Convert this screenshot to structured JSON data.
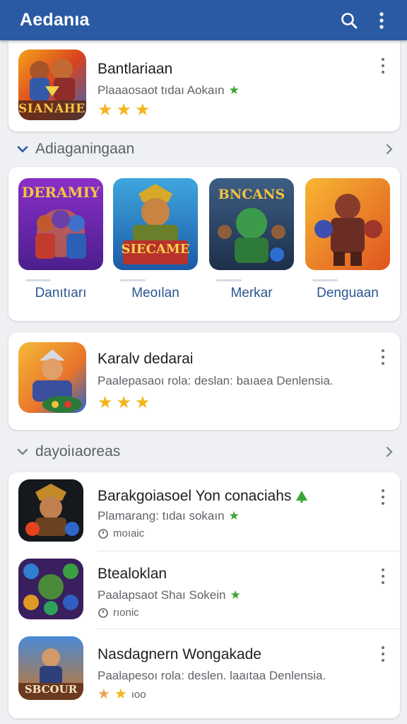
{
  "app_bar": {
    "title": "Aedanıa",
    "bg_color": "#2a5aa3",
    "search_icon": "search-icon",
    "more_icon": "more-vert-icon"
  },
  "featured": {
    "title": "Bantlariaan",
    "subtitle": "Plaaaosaot tıdaı Aokaın",
    "rating_stars": 3,
    "icon_text": "SIANAHES"
  },
  "section1": {
    "label": "Adiaganingaan",
    "expand_icon": "chevron-down-icon",
    "nav_icon": "chevron-right-icon"
  },
  "carousel": [
    {
      "label": "Danıtıarı",
      "art_text": "DERAMIY"
    },
    {
      "label": "Meoılan",
      "art_text": "SIECAME"
    },
    {
      "label": "Merkar",
      "art_text": "BNCANS"
    },
    {
      "label": "Denguaan",
      "art_text": ""
    }
  ],
  "card2": {
    "title": "Karalv dedarai",
    "subtitle": "Paaleраsaoı rola: deslan: baıaea Denlensia.",
    "rating_stars": 3
  },
  "section2": {
    "label": "dayoiıaoreas",
    "expand_icon": "chevron-down-icon",
    "nav_icon": "chevron-right-icon"
  },
  "list": [
    {
      "title": "Barakgoiasoel Yon conaciahs",
      "subtitle": "Plamarang: tıdaı sokaın",
      "meta": "moıaic",
      "rating_stars": 0,
      "badge": "tree-icon"
    },
    {
      "title": "Btealoklan",
      "subtitle": "Paalapsaot Shaı Sokein",
      "meta": "rıonic",
      "rating_stars": 0
    },
    {
      "title": "Nasdagnern Wongakade",
      "subtitle": "Paalapesoı rola: deslen. laaıtaa Denlensia.",
      "meta": "ıoo",
      "rating_stars": 2,
      "icon_text": "SBCOUR"
    }
  ]
}
